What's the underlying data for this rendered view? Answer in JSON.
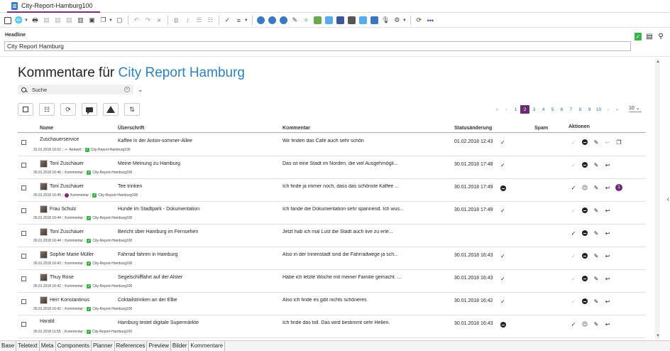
{
  "window": {
    "title": "City-Report-Hamburg100"
  },
  "headline": {
    "label": "Headline",
    "value": "City Report Hamburg"
  },
  "page": {
    "title_prefix": "Kommentare für",
    "title_accent": "City Report Hamburg"
  },
  "search": {
    "value": "Suche"
  },
  "pager": {
    "pages": [
      "«",
      "‹",
      "1",
      "2",
      "3",
      "4",
      "5",
      "6",
      "7",
      "8",
      "9",
      "10",
      "›",
      "»"
    ],
    "active": "2",
    "per_page": "10"
  },
  "columns": {
    "name": "Name",
    "title": "Überschrift",
    "comment": "Kommentar",
    "status_change": "Statusänderung",
    "spam": "Spam",
    "actions": "Aktionen"
  },
  "rows": [
    {
      "name": "Zuschauerservice",
      "avatar": false,
      "title": "Kaffee in der Anton-sommer-Allee",
      "comment": "Wir finden das Café auch sehr schön",
      "meta_date": "31.01.2018 10:52",
      "meta_type": "Antwort",
      "meta_ref": "City-Report-Hamburg100",
      "status_date": "01.02.2018 12:43",
      "status_icon": "check",
      "extra": "copy"
    },
    {
      "name": "Toni Zuschauer",
      "avatar": true,
      "title": "Meine Meinung zu Hamburg",
      "comment": "Das ist eine Stadt im Norden, die viel Ausgehmögli...",
      "meta_date": "30.01.2018 16:46",
      "meta_type": "Kommentar",
      "meta_ref": "City-Report-Hamburg100",
      "status_date": "30.01.2018 17:48",
      "status_icon": "check",
      "extra": ""
    },
    {
      "name": "Toni Zuschauer",
      "avatar": true,
      "title": "Tee trinken",
      "comment": "Ich finde ja immer noch, dass das schönste Kaffee ...",
      "meta_date": "30.01.2018 16:45",
      "meta_type": "Kommentar",
      "meta_ref": "City-Report-Hamburg100",
      "status_date": "30.01.2018 17:49",
      "status_icon": "minus",
      "extra": "1"
    },
    {
      "name": "Frau Schulz",
      "avatar": true,
      "title": "Hunde im Stadtpark - Dokumentation",
      "comment": "Ich fande die Dokumentation sehr spannend. Ich wus...",
      "meta_date": "30.01.2018 16:44",
      "meta_type": "Kommentar",
      "meta_ref": "City-Report-Hamburg100",
      "status_date": "30.01.2018 17:49",
      "status_icon": "check",
      "extra": ""
    },
    {
      "name": "Toni Zuschauer",
      "avatar": true,
      "title": "Bericht über Hamburg im Fernsehen",
      "comment": "Jetzt hab ich mal Lust die Stadt auch live zu erle...",
      "meta_date": "30.01.2018 16:44",
      "meta_type": "Kommentar",
      "meta_ref": "City-Report-Hamburg100",
      "status_date": "",
      "status_icon": "",
      "extra": ""
    },
    {
      "name": "Sophie Marie Müller",
      "avatar": true,
      "title": "Fahrrad fahren in Hamburg",
      "comment": "Also in der Innenstadt sind die Fahrradwege ja sch...",
      "meta_date": "30.01.2018 16:43",
      "meta_type": "Kommentar",
      "meta_ref": "City-Report-Hamburg100",
      "status_date": "30.01.2018 16:43",
      "status_icon": "check",
      "extra": ""
    },
    {
      "name": "Thuy Rose",
      "avatar": true,
      "title": "Segelschifffahrt auf der Alster",
      "comment": "Habe ich letzte Woche mit meiner Familie gemacht. ...",
      "meta_date": "30.01.2018 16:42",
      "meta_type": "Kommentar",
      "meta_ref": "City-Report-Hamburg100",
      "status_date": "30.01.2018 16:43",
      "status_icon": "check",
      "extra": ""
    },
    {
      "name": "Herr Konstantinus",
      "avatar": true,
      "title": "Coktailstrinken an der Elbe",
      "comment": "Also ich finde es gibt nichts schöneres",
      "meta_date": "30.01.2018 16:42",
      "meta_type": "Kommentar",
      "meta_ref": "City-Report-Hamburg100",
      "status_date": "30.01.2018 16:42",
      "status_icon": "check",
      "extra": ""
    },
    {
      "name": "Harald",
      "avatar": false,
      "title": "Hamburg testet digitale Supermärkte",
      "comment": "Ich finde das toll. Das wird bestimmt sehr Hellen.",
      "meta_date": "30.01.2018 11:55",
      "meta_type": "Kommentar",
      "meta_ref": "City-Report-Hamburg100",
      "status_date": "30.01.2018 16:43",
      "status_icon": "minus",
      "extra": ""
    }
  ],
  "bottom_tabs": [
    "Base",
    "Teletext",
    "Meta",
    "Components",
    "Planner",
    "References",
    "Preview",
    "Bilder",
    "Kommentare"
  ],
  "active_tab": "Kommentare",
  "colors": {
    "accent": "#2f7fc1",
    "brand": "#6b2d72",
    "ok": "#3bb34a"
  }
}
